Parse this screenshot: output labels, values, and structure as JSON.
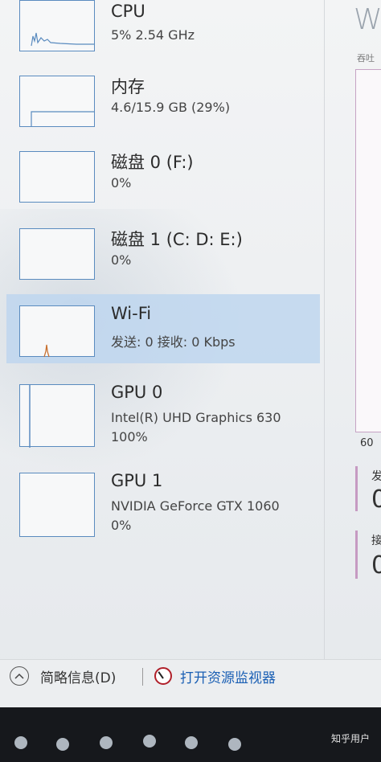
{
  "perf_items": [
    {
      "title": "CPU",
      "subtitle": "5% 2.54 GHz",
      "selected": false
    },
    {
      "title": "内存",
      "subtitle": "4.6/15.9 GB (29%)",
      "selected": false
    },
    {
      "title": "磁盘 0 (F:)",
      "subtitle": "0%",
      "selected": false
    },
    {
      "title": "磁盘 1 (C: D: E:)",
      "subtitle": "0%",
      "selected": false
    },
    {
      "title": "Wi-Fi",
      "subtitle": "发送: 0 接收: 0 Kbps",
      "selected": true
    },
    {
      "title": "GPU 0",
      "subtitle": "Intel(R) UHD Graphics 630",
      "subtitle2": "100%",
      "selected": false
    },
    {
      "title": "GPU 1",
      "subtitle": "NVIDIA GeForce GTX 1060",
      "subtitle2": "0%",
      "selected": false
    }
  ],
  "right_panel": {
    "title_fragment": "W",
    "graph_label_fragment": "吞吐",
    "axis_fragment": "60",
    "stat1_label_fragment": "发",
    "stat1_value_fragment": "0",
    "stat2_label_fragment": "接",
    "stat2_value_fragment": "0"
  },
  "footer": {
    "collapse_label": "简略信息(D)",
    "open_monitor_label": "打开资源监视器"
  },
  "watermark": "知乎用户",
  "colors": {
    "accent_blue": "#5a8bbf",
    "selected_bg": "#bed6ee",
    "link": "#1a5fb4"
  },
  "icons": {
    "collapse": "chevron-up-circle-icon",
    "monitor": "resource-monitor-icon"
  }
}
